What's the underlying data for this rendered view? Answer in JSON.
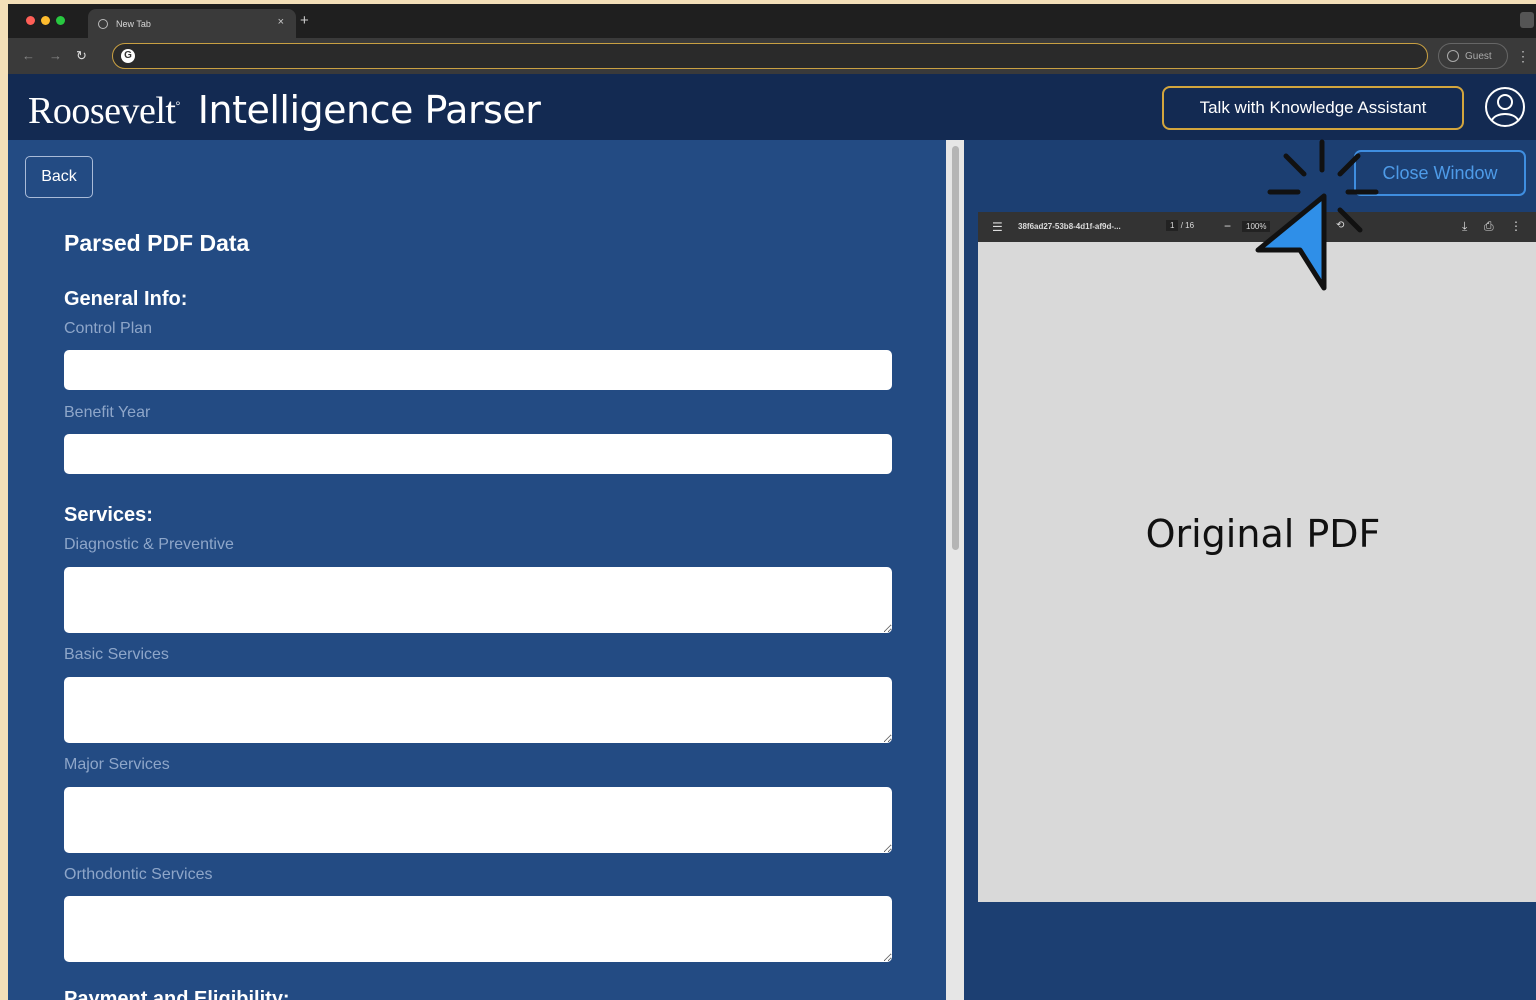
{
  "browser": {
    "tab_title": "New Tab",
    "tab_close": "×",
    "new_tab": "+",
    "guest_label": "Guest",
    "omnibox_icon": "G"
  },
  "header": {
    "logo": "Roosevelt",
    "product": "Intelligence Parser",
    "assistant_button": "Talk with Knowledge Assistant"
  },
  "left": {
    "back_label": "Back",
    "title": "Parsed PDF Data",
    "general_info": {
      "heading": "General Info:",
      "fields": [
        {
          "label": "Control Plan",
          "value": ""
        },
        {
          "label": "Benefit Year",
          "value": ""
        }
      ]
    },
    "services": {
      "heading": "Services:",
      "fields": [
        {
          "label": "Diagnostic & Preventive",
          "value": ""
        },
        {
          "label": "Basic Services",
          "value": ""
        },
        {
          "label": "Major Services",
          "value": ""
        },
        {
          "label": "Orthodontic Services",
          "value": ""
        }
      ]
    },
    "next_heading": "Payment and Eligibility:"
  },
  "right": {
    "close_label": "Close Window",
    "pdf": {
      "filename": "38f6ad27-53b8-4d1f-af9d-...",
      "page_current": "1",
      "page_total": "/ 16",
      "zoom": "100%",
      "placeholder": "Original PDF"
    }
  },
  "colors": {
    "header_bg": "#132a52",
    "left_bg": "#234b83",
    "right_bg": "#1c3f72",
    "accent_gold": "#d3a53d",
    "accent_blue": "#3f8ee0"
  }
}
